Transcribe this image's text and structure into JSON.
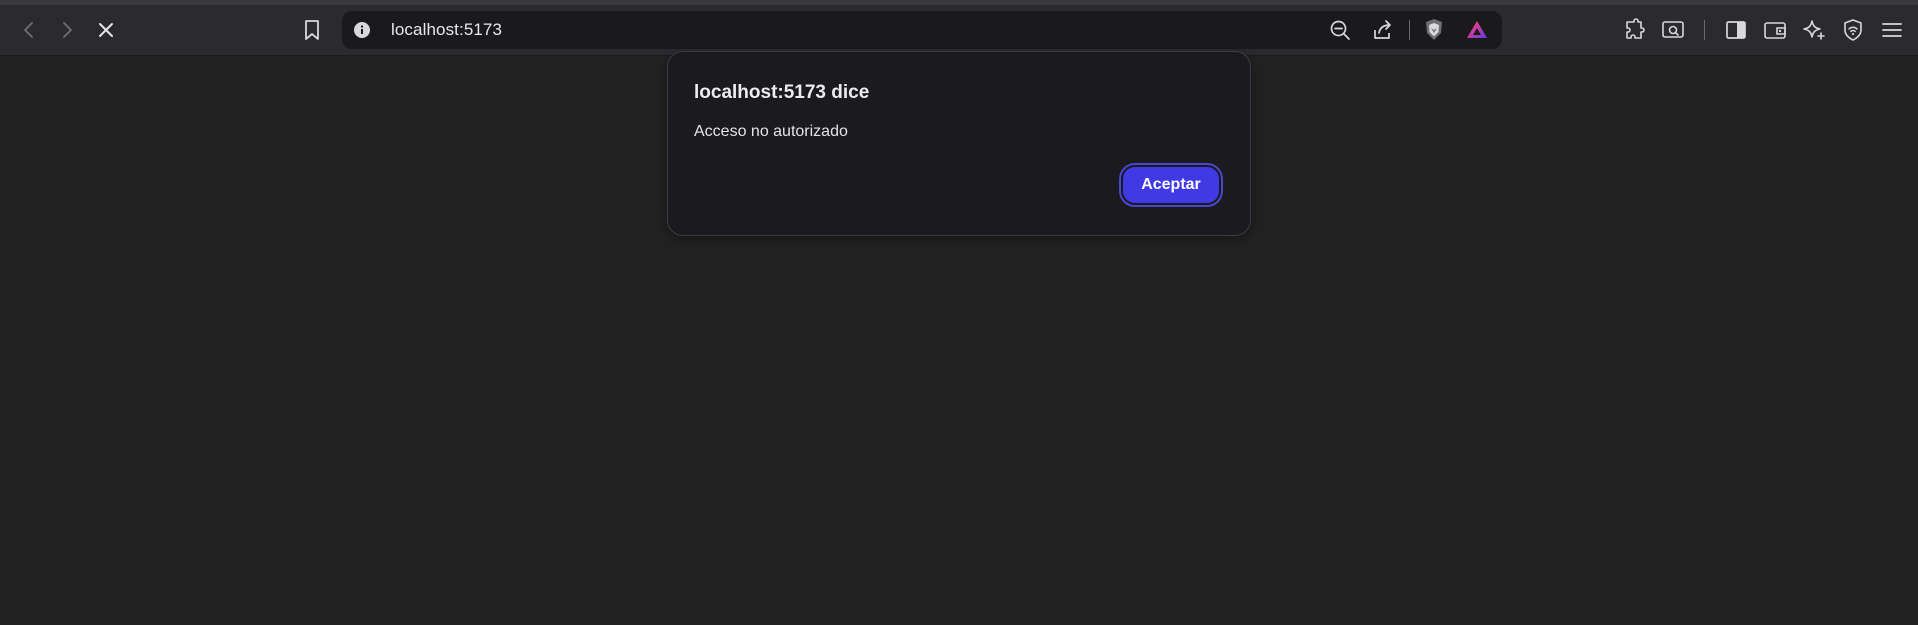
{
  "browser": {
    "address": "localhost:5173",
    "nav": {
      "back_icon": "chevron-left-icon",
      "forward_icon": "chevron-right-icon",
      "stop_icon": "close-icon"
    },
    "toolbar_icons": [
      "bookmark-icon",
      "info-icon",
      "zoom-out-icon",
      "share-icon",
      "brave-shields-icon",
      "brave-rewards-icon",
      "extensions-icon",
      "screenshot-icon",
      "sidebar-icon",
      "wallet-icon",
      "leo-ai-icon",
      "vpn-icon",
      "menu-icon"
    ]
  },
  "dialog": {
    "title": "localhost:5173 dice",
    "message": "Acceso no autorizado",
    "ok_label": "Aceptar"
  },
  "colors": {
    "page_background": "#222222",
    "toolbar_background": "#2b2b2e",
    "dialog_background": "#1b1a1f",
    "accent": "#3f3ae3"
  }
}
